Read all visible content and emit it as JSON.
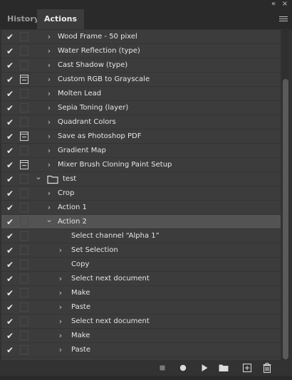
{
  "panel": {
    "tabs": [
      {
        "label": "History",
        "active": false
      },
      {
        "label": "Actions",
        "active": true
      }
    ],
    "icons": {
      "collapse": "«",
      "close": "×",
      "checkmark": "✔",
      "arrow_collapsed": "›",
      "arrow_expanded": "⌄"
    }
  },
  "actions": [
    {
      "label": "Wood Frame - 50 pixel",
      "depth": 1,
      "expander": "collapsed",
      "dialog": false,
      "checked": true
    },
    {
      "label": "Water Reflection (type)",
      "depth": 1,
      "expander": "collapsed",
      "dialog": false,
      "checked": true
    },
    {
      "label": "Cast Shadow (type)",
      "depth": 1,
      "expander": "collapsed",
      "dialog": false,
      "checked": true
    },
    {
      "label": "Custom RGB to Grayscale",
      "depth": 1,
      "expander": "collapsed",
      "dialog": true,
      "checked": true
    },
    {
      "label": "Molten Lead",
      "depth": 1,
      "expander": "collapsed",
      "dialog": false,
      "checked": true
    },
    {
      "label": "Sepia Toning (layer)",
      "depth": 1,
      "expander": "collapsed",
      "dialog": false,
      "checked": true
    },
    {
      "label": "Quadrant Colors",
      "depth": 1,
      "expander": "collapsed",
      "dialog": false,
      "checked": true
    },
    {
      "label": "Save as Photoshop PDF",
      "depth": 1,
      "expander": "collapsed",
      "dialog": true,
      "checked": true
    },
    {
      "label": "Gradient Map",
      "depth": 1,
      "expander": "collapsed",
      "dialog": false,
      "checked": true
    },
    {
      "label": "Mixer Brush Cloning Paint Setup",
      "depth": 1,
      "expander": "collapsed",
      "dialog": true,
      "checked": true
    },
    {
      "label": "test",
      "depth": 0,
      "expander": "expanded",
      "dialog": false,
      "checked": true,
      "folder": true
    },
    {
      "label": "Crop",
      "depth": 1,
      "expander": "collapsed",
      "dialog": false,
      "checked": true
    },
    {
      "label": "Action 1",
      "depth": 1,
      "expander": "collapsed",
      "dialog": false,
      "checked": true
    },
    {
      "label": "Action 2",
      "depth": 1,
      "expander": "expanded",
      "dialog": false,
      "checked": true,
      "selected": true
    },
    {
      "label": "Select channel “Alpha 1”",
      "depth": 2,
      "expander": "none",
      "dialog": false,
      "checked": true
    },
    {
      "label": "Set Selection",
      "depth": 2,
      "expander": "collapsed",
      "dialog": false,
      "checked": true
    },
    {
      "label": "Copy",
      "depth": 2,
      "expander": "none",
      "dialog": false,
      "checked": true
    },
    {
      "label": "Select next document",
      "depth": 2,
      "expander": "collapsed",
      "dialog": false,
      "checked": true
    },
    {
      "label": "Make",
      "depth": 2,
      "expander": "collapsed",
      "dialog": false,
      "checked": true
    },
    {
      "label": "Paste",
      "depth": 2,
      "expander": "collapsed",
      "dialog": false,
      "checked": true
    },
    {
      "label": "Select next document",
      "depth": 2,
      "expander": "collapsed",
      "dialog": false,
      "checked": true
    },
    {
      "label": "Make",
      "depth": 2,
      "expander": "collapsed",
      "dialog": false,
      "checked": true
    },
    {
      "label": "Paste",
      "depth": 2,
      "expander": "collapsed",
      "dialog": false,
      "checked": true
    }
  ],
  "toolbar": [
    {
      "name": "stop-icon",
      "kind": "stop"
    },
    {
      "name": "record-icon",
      "kind": "record"
    },
    {
      "name": "play-icon",
      "kind": "play"
    },
    {
      "name": "new-set-folder-icon",
      "kind": "folder"
    },
    {
      "name": "new-action-icon",
      "kind": "new"
    },
    {
      "name": "trash-icon",
      "kind": "trash"
    }
  ],
  "colors": {
    "panel_bg": "#3c3c3c",
    "selected_row": "#535353",
    "text": "#e6e6e6"
  }
}
